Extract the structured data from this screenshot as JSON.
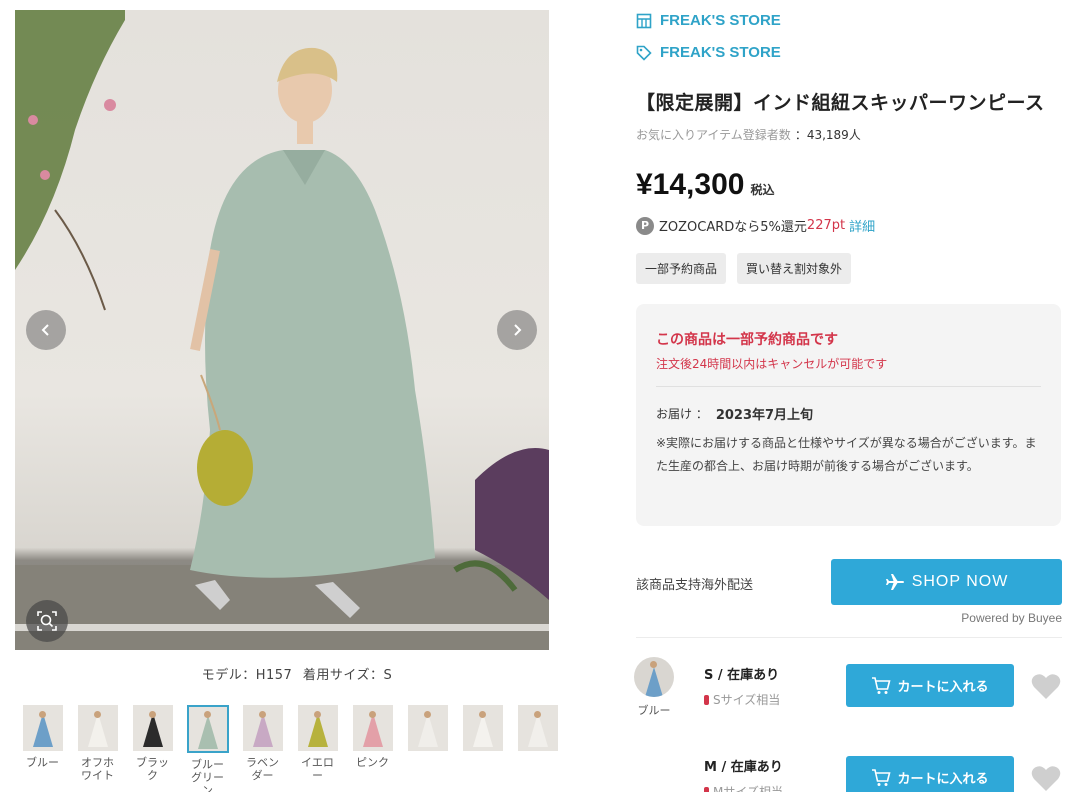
{
  "gallery": {
    "model_caption": {
      "model": "モデル：H157",
      "size": "着用サイズ：S"
    },
    "colors": [
      {
        "label": "ブルー",
        "swatch": "#6d9fc8"
      },
      {
        "label": "オフホワイト",
        "swatch": "#f3f1ec"
      },
      {
        "label": "ブラック",
        "swatch": "#2b2b2b"
      },
      {
        "label": "ブルーグリーン",
        "swatch": "#a9bfb0",
        "selected": true
      },
      {
        "label": "ラベンダー",
        "swatch": "#c8a9c4"
      },
      {
        "label": "イエロー",
        "swatch": "#b7b23d"
      },
      {
        "label": "ピンク",
        "swatch": "#e3a0a8"
      },
      {
        "label": "",
        "swatch": "#f0eeea"
      },
      {
        "label": "",
        "swatch": "#f4f2ee"
      },
      {
        "label": "",
        "swatch": "#f1efeb"
      }
    ]
  },
  "store": {
    "shop_name": "FREAK'S STORE",
    "brand_name": "FREAK'S STORE"
  },
  "product": {
    "title": "【限定展開】インド組紐スキッパーワンピース",
    "fav_label": "お気に入りアイテム登録者数",
    "fav_value": "：43,189人",
    "price": "¥14,300",
    "tax_label": "税込",
    "card": {
      "badge": "P",
      "text": "ZOZOCARDなら5%還元",
      "points": "227pt",
      "detail": "詳細"
    },
    "tags": [
      "一部予約商品",
      "買い替え割対象外"
    ]
  },
  "reservation": {
    "title": "この商品は一部予約商品です",
    "subtitle": "注文後24時間以内はキャンセルが可能です",
    "delivery_label": "お届け ：",
    "delivery_date": "2023年7月上旬",
    "note": "※実際にお届けする商品と仕様やサイズが異なる場合がございます。また生産の都合上、お届け時期が前後する場合がございます。"
  },
  "buyee": {
    "overseas_text": "該商品支持海外配送",
    "shop_now": "SHOP NOW",
    "powered": "Powered by Buyee"
  },
  "variants": {
    "color_name": "ブルー",
    "rows": [
      {
        "stock": "S / 在庫あり",
        "hint": "Sサイズ相当",
        "cart": "カートに入れる"
      },
      {
        "stock": "M / 在庫あり",
        "hint": "Mサイズ相当",
        "cart": "カートに入れる"
      }
    ]
  },
  "colors": {
    "accent": "#2fa8d8",
    "alert": "#d3354a",
    "link": "#2fa3c8"
  }
}
